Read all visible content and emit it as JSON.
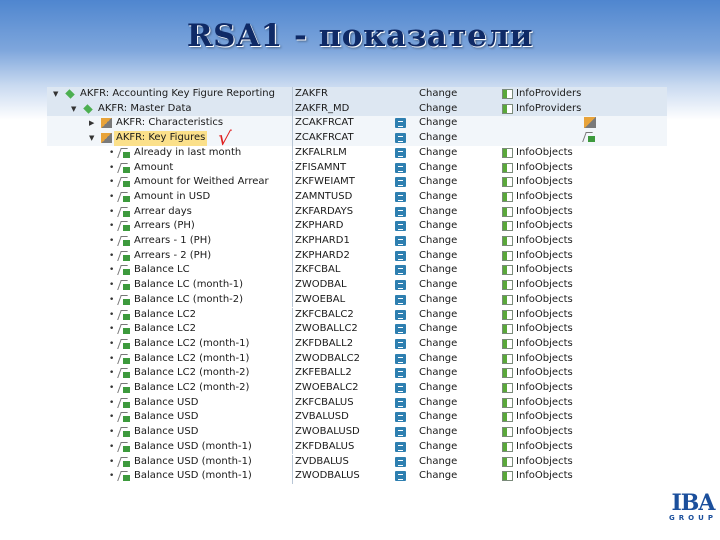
{
  "title": "RSA1 - показатели",
  "logo": {
    "main": "IBA",
    "sub": "GROUP"
  },
  "colors": {
    "title": "#0f2a66",
    "selected": "#fbe08a",
    "action_icon": "#2e7fb0",
    "checkmark": "#e02020"
  },
  "rows": [
    {
      "name": "AKFR: Accounting Key Figure Reporting",
      "tech": "ZAKFR",
      "action": false,
      "change": "Change",
      "type": "InfoProviders",
      "level": 0,
      "icon": "infoarea-icon",
      "expand": "expanded"
    },
    {
      "name": "AKFR: Master Data",
      "tech": "ZAKFR_MD",
      "action": false,
      "change": "Change",
      "type": "InfoProviders",
      "level": 1,
      "icon": "infoarea-icon",
      "expand": "expanded"
    },
    {
      "name": "AKFR: Characteristics",
      "tech": "ZCAKFRCAT",
      "action": true,
      "change": "Change",
      "type": "",
      "level": 2,
      "icon": "catalog-icon",
      "expand": "collapsed"
    },
    {
      "name": "AKFR: Key Figures",
      "tech": "ZCAKFRCAT",
      "action": true,
      "change": "Change",
      "type": "",
      "level": 2,
      "icon": "catalog-icon",
      "expand": "expanded",
      "selected": true
    },
    {
      "name": "Already in last month",
      "tech": "ZKFALRLM",
      "action": true,
      "change": "Change",
      "type": "InfoObjects",
      "level": 3,
      "icon": "key-figure-icon"
    },
    {
      "name": "Amount",
      "tech": "ZFISAMNT",
      "action": true,
      "change": "Change",
      "type": "InfoObjects",
      "level": 3,
      "icon": "key-figure-icon"
    },
    {
      "name": "Amount for Weithed Arrear",
      "tech": "ZKFWEIAMT",
      "action": true,
      "change": "Change",
      "type": "InfoObjects",
      "level": 3,
      "icon": "key-figure-icon"
    },
    {
      "name": "Amount in USD",
      "tech": "ZAMNTUSD",
      "action": true,
      "change": "Change",
      "type": "InfoObjects",
      "level": 3,
      "icon": "key-figure-icon"
    },
    {
      "name": "Arrear days",
      "tech": "ZKFARDAYS",
      "action": true,
      "change": "Change",
      "type": "InfoObjects",
      "level": 3,
      "icon": "key-figure-icon"
    },
    {
      "name": "Arrears (PH)",
      "tech": "ZKPHARD",
      "action": true,
      "change": "Change",
      "type": "InfoObjects",
      "level": 3,
      "icon": "key-figure-icon"
    },
    {
      "name": "Arrears - 1 (PH)",
      "tech": "ZKPHARD1",
      "action": true,
      "change": "Change",
      "type": "InfoObjects",
      "level": 3,
      "icon": "key-figure-icon"
    },
    {
      "name": "Arrears - 2 (PH)",
      "tech": "ZKPHARD2",
      "action": true,
      "change": "Change",
      "type": "InfoObjects",
      "level": 3,
      "icon": "key-figure-icon"
    },
    {
      "name": "Balance LC",
      "tech": "ZKFCBAL",
      "action": true,
      "change": "Change",
      "type": "InfoObjects",
      "level": 3,
      "icon": "key-figure-icon"
    },
    {
      "name": "Balance LC (month-1)",
      "tech": "ZWODBAL",
      "action": true,
      "change": "Change",
      "type": "InfoObjects",
      "level": 3,
      "icon": "key-figure-icon"
    },
    {
      "name": "Balance LC (month-2)",
      "tech": "ZWOEBAL",
      "action": true,
      "change": "Change",
      "type": "InfoObjects",
      "level": 3,
      "icon": "key-figure-icon"
    },
    {
      "name": "Balance LC2",
      "tech": "ZKFCBALC2",
      "action": true,
      "change": "Change",
      "type": "InfoObjects",
      "level": 3,
      "icon": "key-figure-icon"
    },
    {
      "name": "Balance LC2",
      "tech": "ZWOBALLC2",
      "action": true,
      "change": "Change",
      "type": "InfoObjects",
      "level": 3,
      "icon": "key-figure-icon"
    },
    {
      "name": "Balance LC2 (month-1)",
      "tech": "ZKFDBALL2",
      "action": true,
      "change": "Change",
      "type": "InfoObjects",
      "level": 3,
      "icon": "key-figure-icon"
    },
    {
      "name": "Balance LC2 (month-1)",
      "tech": "ZWODBALC2",
      "action": true,
      "change": "Change",
      "type": "InfoObjects",
      "level": 3,
      "icon": "key-figure-icon"
    },
    {
      "name": "Balance LC2 (month-2)",
      "tech": "ZKFEBALL2",
      "action": true,
      "change": "Change",
      "type": "InfoObjects",
      "level": 3,
      "icon": "key-figure-icon"
    },
    {
      "name": "Balance LC2 (month-2)",
      "tech": "ZWOEBALC2",
      "action": true,
      "change": "Change",
      "type": "InfoObjects",
      "level": 3,
      "icon": "key-figure-icon"
    },
    {
      "name": "Balance USD",
      "tech": "ZKFCBALUS",
      "action": true,
      "change": "Change",
      "type": "InfoObjects",
      "level": 3,
      "icon": "key-figure-icon"
    },
    {
      "name": "Balance USD",
      "tech": "ZVBALUSD",
      "action": true,
      "change": "Change",
      "type": "InfoObjects",
      "level": 3,
      "icon": "key-figure-icon"
    },
    {
      "name": "Balance USD",
      "tech": "ZWOBALUSD",
      "action": true,
      "change": "Change",
      "type": "InfoObjects",
      "level": 3,
      "icon": "key-figure-icon"
    },
    {
      "name": "Balance USD (month-1)",
      "tech": "ZKFDBALUS",
      "action": true,
      "change": "Change",
      "type": "InfoObjects",
      "level": 3,
      "icon": "key-figure-icon"
    },
    {
      "name": "Balance USD (month-1)",
      "tech": "ZVDBALUS",
      "action": true,
      "change": "Change",
      "type": "InfoObjects",
      "level": 3,
      "icon": "key-figure-icon"
    },
    {
      "name": "Balance USD (month-1)",
      "tech": "ZWODBALUS",
      "action": true,
      "change": "Change",
      "type": "InfoObjects",
      "level": 3,
      "icon": "key-figure-icon"
    }
  ]
}
